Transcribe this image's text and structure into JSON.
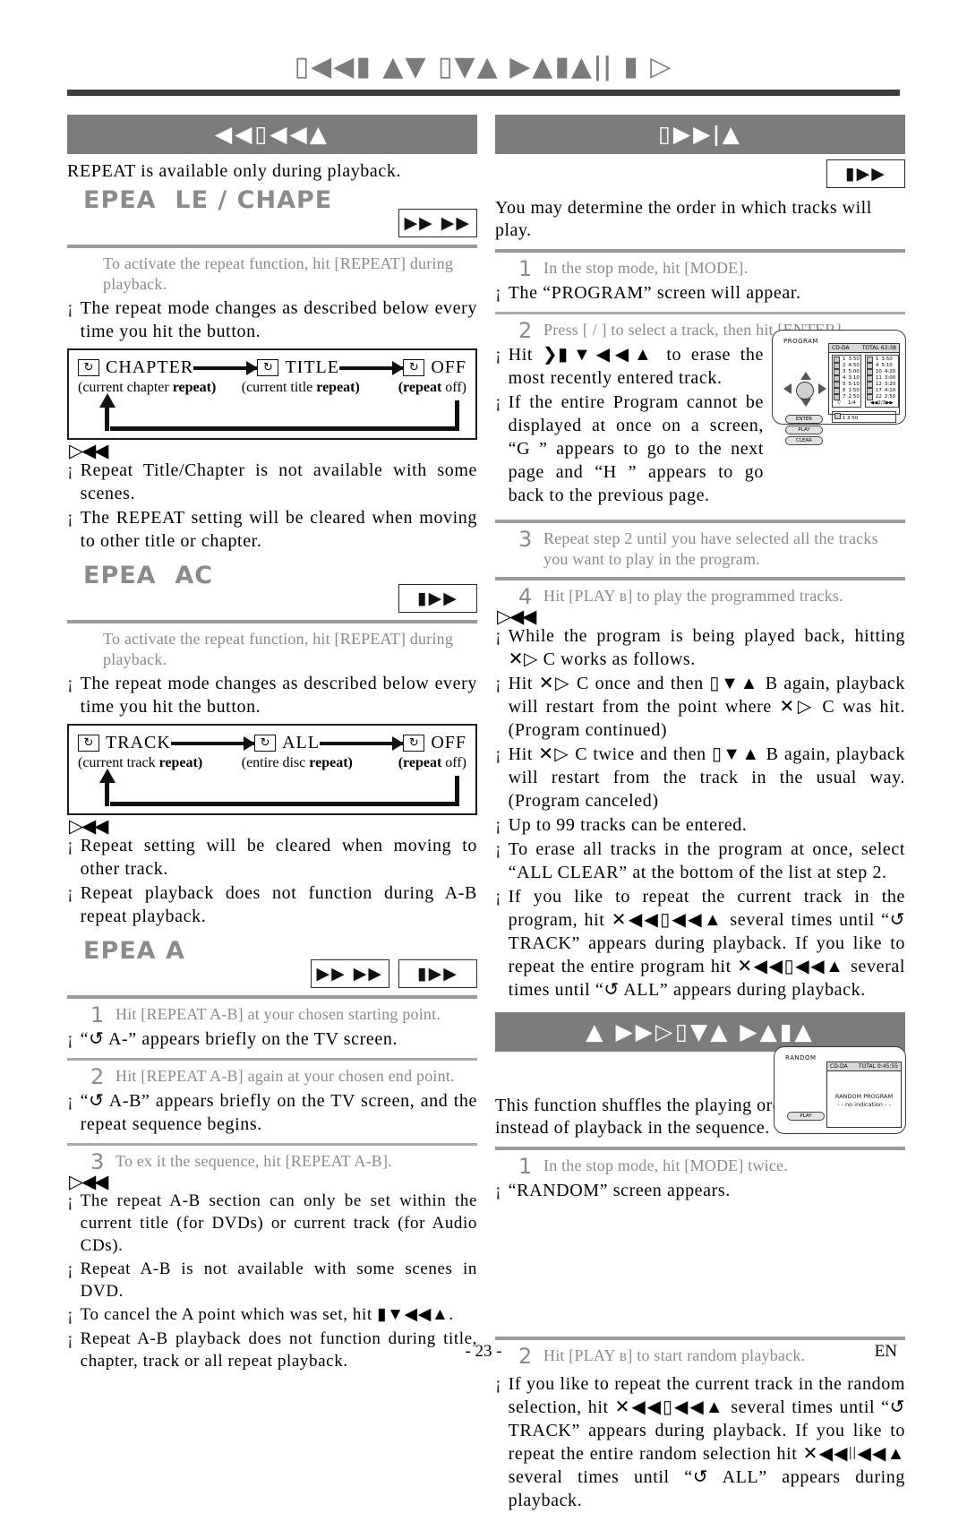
{
  "header": {
    "glyph_title": "▯◀◀▮ ▲▼ ▯▼▲ ▶▲▮▲ǀǀ ▮ ▷"
  },
  "left_column": {
    "banner": "◀◀▯◀◀▲",
    "lead": "REPEAT is available only during playback.",
    "section_title_chapter": "EPEA  LE / CHAPE",
    "badges_chapter": [
      "▶▶ ▶▶"
    ],
    "chapter_step": "To activate the repeat function, hit [REPEAT] during playback.",
    "chapter_bullet": "The repeat mode changes as described below every time you hit the button.",
    "flow_chapter": {
      "nodes": [
        "CHAPTER",
        "TITLE",
        "OFF"
      ],
      "subs": [
        "(current chapter",
        "repeat)",
        "(current title",
        "repeat)",
        "(repeat",
        "off)"
      ]
    },
    "chapter_notes": [
      "Repeat Title/Chapter is not available with some scenes.",
      "The REPEAT setting will be cleared when moving to other title or chapter."
    ],
    "section_title_track": "EPEA  AC",
    "badges_track": [
      "▮▶▶"
    ],
    "track_step": "To activate the repeat function, hit [REPEAT] during playback.",
    "track_bullet": "The repeat mode changes as described below every time you hit the button.",
    "flow_track": {
      "nodes": [
        "TRACK",
        "ALL",
        "OFF"
      ],
      "subs": [
        "(current track",
        "repeat)",
        "(entire disc",
        "repeat)",
        "(repeat",
        "off)"
      ]
    },
    "track_notes": [
      "Repeat setting will be cleared when moving to other track.",
      "Repeat playback does not function during A-B repeat playback."
    ],
    "section_title_ab": "EPEA A",
    "badges_ab": [
      "▶▶ ▶▶",
      "▮▶▶"
    ],
    "ab_steps": [
      {
        "num": "1",
        "text": "Hit [REPEAT A-B] at your chosen starting point."
      },
      {
        "num": "2",
        "text": "Hit [REPEAT A-B] again at your chosen end point."
      },
      {
        "num": "3",
        "text": "To ex it the sequence, hit [REPEAT A-B]."
      }
    ],
    "ab_bullet_1": "“↺ A-” appears briefly on the TV screen.",
    "ab_bullet_2": "“↺ A-B” appears briefly on the TV screen, and the repeat sequence begins.",
    "ab_notes": [
      "The repeat A-B section can only be set within the current title (for DVDs) or current track (for Audio CDs).",
      "Repeat A-B is not available with some scenes in DVD.",
      "To cancel the A point which was set, hit ▮▼◀◀▲.",
      "Repeat A-B playback does not function during title, chapter, track or all repeat playback."
    ]
  },
  "right_column": {
    "banner_program": "▯▶▶ǀ▲",
    "badges_program": [
      "▮▶▶"
    ],
    "program_lead": "You may determine the order in which tracks will play.",
    "program_steps": [
      {
        "num": "1",
        "text": "In the stop mode, hit [MODE]."
      },
      {
        "num": "2",
        "text": "Press [    /    ] to select a track, then hit [ENTER]."
      },
      {
        "num": "3",
        "text": "Repeat step   2 until you have selected all the tracks you want to play in the program."
      },
      {
        "num": "4",
        "text": "Hit [PLAY ʙ] to play the programmed tracks."
      }
    ],
    "program_bullet_1": "The “PROGRAM” screen will appear.",
    "program_bullets_2": [
      "Hit ❯▮▼◀◀▲ to erase the most recently entered track.",
      "If the entire Program cannot be displayed at once on a screen, “G  ” appears to go to the next page and “H ” appears to go back to the previous page."
    ],
    "program_notes": [
      "While the program is being played back, hitting ✕▷  C works as follows.",
      "Hit ✕▷  C once and then ▯▼▲ B again, playback will restart from the point where ✕▷  C was hit. (Program continued)",
      "Hit ✕▷  C twice and then ▯▼▲ B again, playback will restart from the track in the usual way. (Program canceled)",
      "Up to 99 tracks can be entered.",
      "To erase all tracks in the program at once, select “ALL CLEAR” at the bottom of the list at step 2.",
      "If you like to repeat the current track in the program, hit ✕◀◀▯◀◀▲ several times until “↺ TRACK” appears during playback. If you like to repeat the entire program hit ✕◀◀▯◀◀▲ several times until “↺ ALL” appears during playback."
    ],
    "banner_random": "▲ ▶▶▷▯▼▲ ▶▲▮▲",
    "badges_random": [
      "▮▶▶"
    ],
    "random_lead": "This function shuffles the playing order of tracks instead of playback in the sequence.",
    "random_steps": [
      {
        "num": "1",
        "text": "In the stop mode, hit [MODE] twice."
      },
      {
        "num": "2",
        "text": "Hit [PLAY ʙ] to start random playback."
      }
    ],
    "random_bullet_1": "“RANDOM” screen appears.",
    "random_notes": [
      "If you like to repeat the current track in the random selection, hit ✕◀◀▯◀◀▲ several times until “↺ TRACK” appears during playback. If you like to repeat the entire random selection hit ✕◀◀ǀǀ◀◀▲ several times until “↺ ALL” appears during playback."
    ]
  },
  "osd_program": {
    "label": "PROGRAM",
    "disc_type": "CD-DA",
    "total": "TOTAL 63:38",
    "left_tracks": [
      {
        "no": "1",
        "time": "3:50"
      },
      {
        "no": "2",
        "time": "4:50"
      },
      {
        "no": "3",
        "time": "5:00"
      },
      {
        "no": "4",
        "time": "3:10"
      },
      {
        "no": "5",
        "time": "5:10"
      },
      {
        "no": "6",
        "time": "1:50"
      },
      {
        "no": "7",
        "time": "2:50"
      }
    ],
    "right_tracks": [
      {
        "no": "1",
        "time": "3:50"
      },
      {
        "no": "4",
        "time": "5:10"
      },
      {
        "no": "10",
        "time": "4:20"
      },
      {
        "no": "11",
        "time": "3:00"
      },
      {
        "no": "12",
        "time": "3:20"
      },
      {
        "no": "17",
        "time": "4:10"
      },
      {
        "no": "22",
        "time": "2:50"
      }
    ],
    "left_page": "1/4",
    "right_page": "2/3",
    "bottom_row": "1   3:50",
    "buttons": [
      "ENTER",
      "PLAY",
      "CLEAR"
    ]
  },
  "osd_random": {
    "label": "RANDOM",
    "disc_type": "CD-DA",
    "total": "TOTAL 0:45:55",
    "center_line1": "RANDOM PROGRAM",
    "center_line2": "- - no indication - -",
    "buttons": [
      "PLAY"
    ]
  },
  "footer": {
    "page": "- 23 -",
    "lang": "EN"
  }
}
